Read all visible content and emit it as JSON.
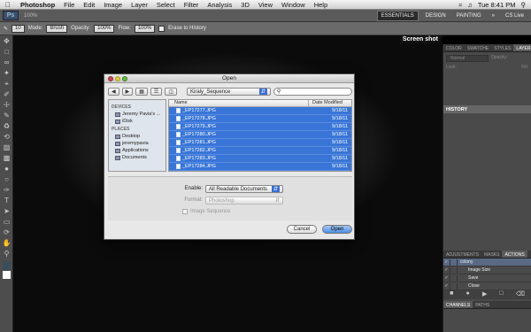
{
  "menubar": {
    "app": "Photoshop",
    "items": [
      "File",
      "Edit",
      "Image",
      "Layer",
      "Select",
      "Filter",
      "Analysis",
      "3D",
      "View",
      "Window",
      "Help"
    ],
    "clock": "Tue 8:41 PM"
  },
  "appbar": {
    "logo": "Ps",
    "zoom": "100%",
    "workspaces": [
      "ESSENTIALS",
      "DESIGN",
      "PAINTING"
    ],
    "cslive": "CS Live"
  },
  "options": {
    "brush_size": "10",
    "mode_label": "Mode:",
    "mode_value": "Brush",
    "opacity_label": "Opacity:",
    "opacity_value": "100%",
    "flow_label": "Flow:",
    "flow_value": "100%",
    "erase_history": "Erase to History"
  },
  "canvas": {
    "title": "Screen shot"
  },
  "dialog": {
    "title": "Open",
    "folder": "Kiraly_Sequence",
    "sidebar": {
      "devices_header": "DEVICES",
      "devices": [
        "Jeremy Pavia's ...",
        "iDisk"
      ],
      "places_header": "PLACES",
      "places": [
        "Desktop",
        "jeremypavia",
        "Applications",
        "Documents"
      ]
    },
    "columns": [
      "Name",
      "Date Modified"
    ],
    "files": [
      {
        "name": "_EP17277.JPG",
        "date": "9/18/11"
      },
      {
        "name": "_EP17278.JPG",
        "date": "9/18/11"
      },
      {
        "name": "_EP17279.JPG",
        "date": "9/18/11"
      },
      {
        "name": "_EP17280.JPG",
        "date": "9/18/11"
      },
      {
        "name": "_EP17281.JPG",
        "date": "9/18/11"
      },
      {
        "name": "_EP17282.JPG",
        "date": "9/18/11"
      },
      {
        "name": "_EP17283.JPG",
        "date": "9/18/11"
      },
      {
        "name": "_EP17284.JPG",
        "date": "9/18/11"
      }
    ],
    "enable_label": "Enable:",
    "enable_value": "All Readable Documents",
    "format_label": "Format:",
    "format_value": "Photoshop",
    "image_sequence": "Image Sequence",
    "cancel": "Cancel",
    "open": "Open"
  },
  "panels": {
    "top_tabs": [
      "COLOR",
      "SWATCHE",
      "STYLES",
      "LAYERS"
    ],
    "blend_mode": "Normal",
    "opacity_label": "Opacity:",
    "lock_label": "Lock:",
    "fill_label": "Fill:",
    "history": "HISTORY",
    "bottom_tabs": [
      "ADJUSTMENTS",
      "MASKS",
      "ACTIONS"
    ],
    "actions": [
      "colony",
      "Image Size",
      "Save",
      "Close"
    ],
    "footer_tabs": [
      "CHANNELS",
      "PATHS"
    ]
  }
}
